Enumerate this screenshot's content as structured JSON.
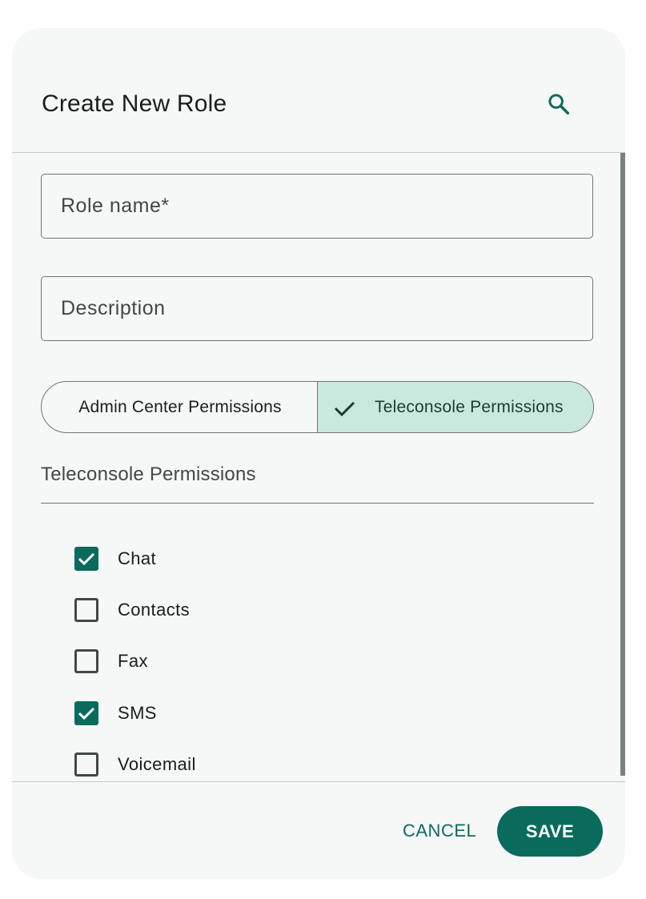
{
  "dialog": {
    "title": "Create New Role"
  },
  "form": {
    "role_name_placeholder": "Role name*",
    "role_name_value": "",
    "description_placeholder": "Description",
    "description_value": ""
  },
  "tabs": [
    {
      "label": "Admin Center Permissions",
      "selected": false
    },
    {
      "label": "Teleconsole Permissions",
      "selected": true
    }
  ],
  "section": {
    "title": "Teleconsole Permissions"
  },
  "permissions": [
    {
      "label": "Chat",
      "checked": true
    },
    {
      "label": "Contacts",
      "checked": false
    },
    {
      "label": "Fax",
      "checked": false
    },
    {
      "label": "SMS",
      "checked": true
    },
    {
      "label": "Voicemail",
      "checked": false
    }
  ],
  "actions": {
    "cancel_label": "CANCEL",
    "save_label": "SAVE"
  },
  "colors": {
    "primary": "#0a6b5d",
    "selected_segment": "#c9e9df",
    "surface": "#f6f8f7"
  }
}
